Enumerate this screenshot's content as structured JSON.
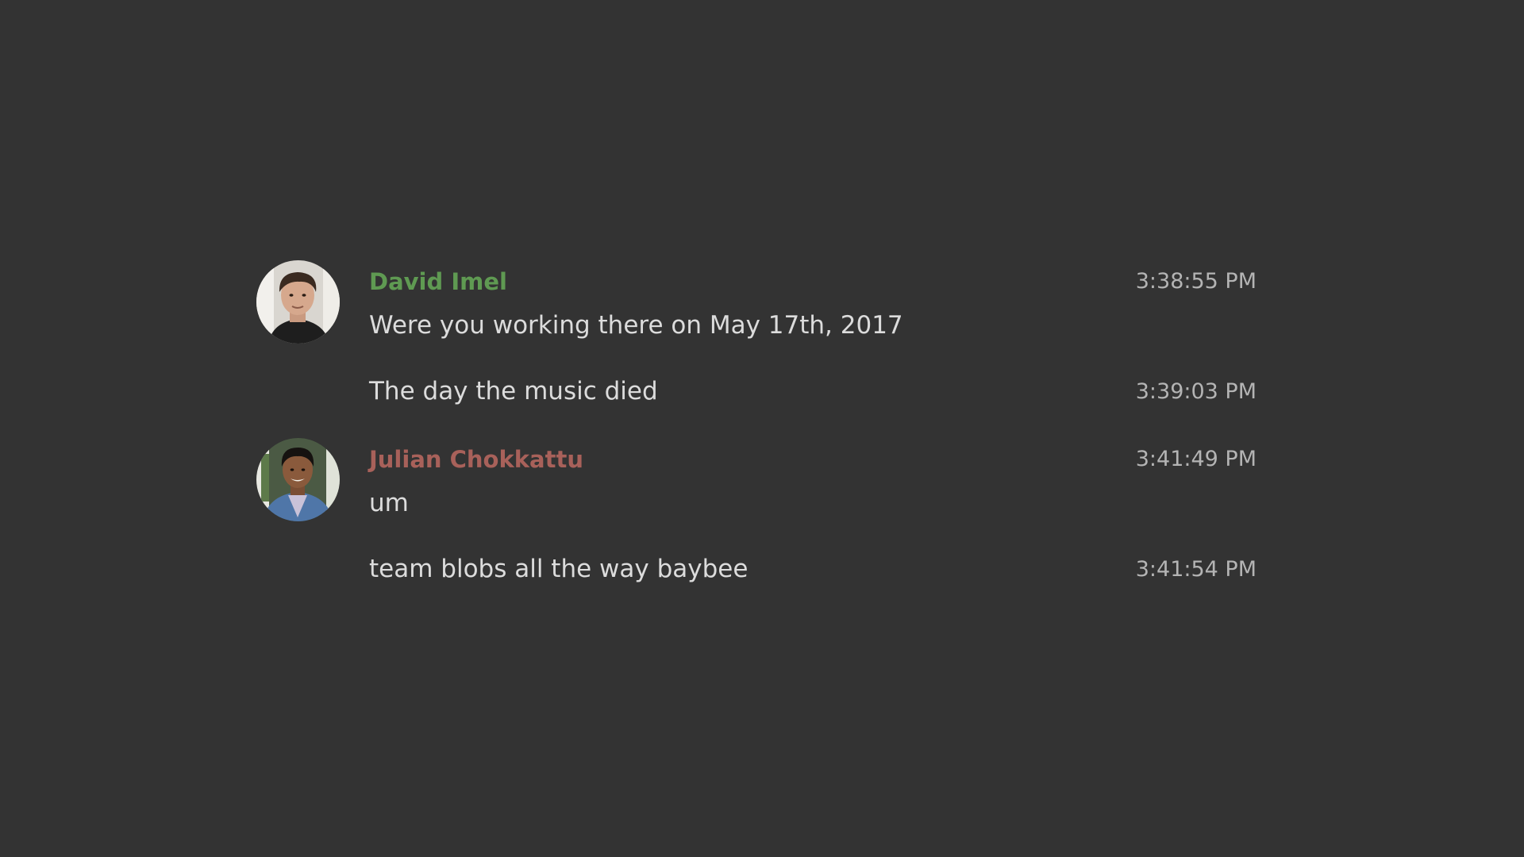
{
  "messages": [
    {
      "author": "David Imel",
      "author_color": "#5f9a52",
      "avatar_icon": "profile-photo",
      "entries": [
        {
          "text": "Were you working there on May 17th, 2017",
          "time": "3:38:55 PM"
        },
        {
          "text": "The day the music died",
          "time": "3:39:03 PM"
        }
      ]
    },
    {
      "author": "Julian Chokkattu",
      "author_color": "#a8615a",
      "avatar_icon": "profile-photo",
      "entries": [
        {
          "text": "um",
          "time": "3:41:49 PM"
        },
        {
          "text": "team blobs all the way baybee",
          "time": "3:41:54 PM"
        }
      ]
    }
  ],
  "colors": {
    "background": "#333333",
    "text": "#dcdcdc",
    "timestamp": "#b4b4b4"
  }
}
